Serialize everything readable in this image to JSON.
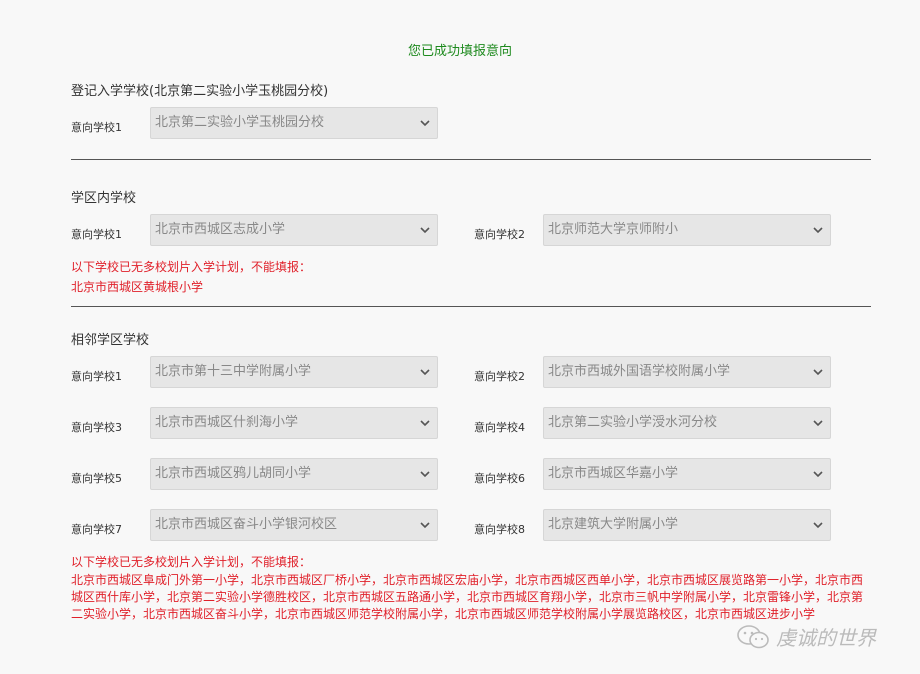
{
  "success_message": "您已成功填报意向",
  "colors": {
    "success": "#1e8a1e",
    "warning": "#e0202a",
    "select_bg": "#e6e6e6"
  },
  "registered": {
    "title": "登记入学学校(北京第二实验小学玉桃园分校)",
    "choices": [
      {
        "label": "意向学校1",
        "value": "北京第二实验小学玉桃园分校"
      }
    ]
  },
  "district": {
    "title": "学区内学校",
    "choices": [
      {
        "label": "意向学校1",
        "value": "北京市西城区志成小学"
      },
      {
        "label": "意向学校2",
        "value": "北京师范大学京师附小"
      }
    ],
    "notice": "以下学校已无多校划片入学计划，不能填报：",
    "list": "北京市西城区黄城根小学"
  },
  "adjacent": {
    "title": "相邻学区学校",
    "choices": [
      {
        "label": "意向学校1",
        "value": "北京市第十三中学附属小学"
      },
      {
        "label": "意向学校2",
        "value": "北京市西城外国语学校附属小学"
      },
      {
        "label": "意向学校3",
        "value": "北京市西城区什刹海小学"
      },
      {
        "label": "意向学校4",
        "value": "北京第二实验小学涭水河分校"
      },
      {
        "label": "意向学校5",
        "value": "北京市西城区鸦儿胡同小学"
      },
      {
        "label": "意向学校6",
        "value": "北京市西城区华嘉小学"
      },
      {
        "label": "意向学校7",
        "value": "北京市西城区奋斗小学银河校区"
      },
      {
        "label": "意向学校8",
        "value": "北京建筑大学附属小学"
      }
    ],
    "notice": "以下学校已无多校划片入学计划，不能填报：",
    "list": "北京市西城区阜成门外第一小学，北京市西城区厂桥小学，北京市西城区宏庙小学，北京市西城区西单小学，北京市西城区展览路第一小学，北京市西城区西什库小学，北京第二实验小学德胜校区，北京市西城区五路通小学，北京市西城区育翔小学，北京市三帆中学附属小学，北京雷锋小学，北京第二实验小学，北京市西城区奋斗小学，北京市西城区师范学校附属小学，北京市西城区师范学校附属小学展览路校区，北京市西城区进步小学"
  },
  "watermark": {
    "text": "虔诚的世界",
    "icon": "wechat-icon"
  }
}
